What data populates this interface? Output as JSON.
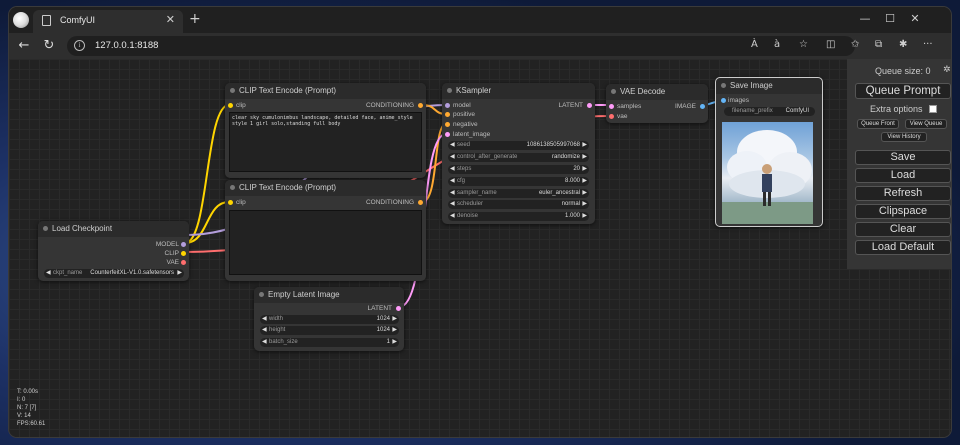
{
  "browser": {
    "tab_title": "ComfyUI",
    "url": "127.0.0.1:8188",
    "window_controls": {
      "minimize": "—",
      "maximize": "☐",
      "close": "✕"
    },
    "tab_close": "✕",
    "new_tab": "+",
    "toolbar_icons": [
      "read-aloud-icon",
      "translate-icon",
      "favorite-icon",
      "split-screen-icon",
      "favorites-icon",
      "collections-icon",
      "extensions-icon",
      "more-icon"
    ],
    "toolbar_glyphs": {
      "read_aloud": "À",
      "translate": "à",
      "favorite": "☆",
      "split": "◫",
      "favorites": "✩",
      "collections": "⧉",
      "extensions": "✱",
      "more": "···"
    },
    "nav_glyphs": {
      "back": "←",
      "refresh": "↻",
      "info": "i"
    }
  },
  "nodes": {
    "clip_text_1": {
      "title": "CLIP Text Encode (Prompt)",
      "input": "clip",
      "output": "CONDITIONING",
      "text": "clear sky cumulonimbus landscape, detailed face, anime_style style 1 girl solo,standing full body"
    },
    "clip_text_2": {
      "title": "CLIP Text Encode (Prompt)",
      "input": "clip",
      "output": "CONDITIONING",
      "text": ""
    },
    "load_checkpoint": {
      "title": "Load Checkpoint",
      "outputs": [
        "MODEL",
        "CLIP",
        "VAE"
      ],
      "widget_label": "ckpt_name",
      "widget_value": "CounterfeitXL-V1.0.safetensors"
    },
    "ksampler": {
      "title": "KSampler",
      "inputs": [
        "model",
        "positive",
        "negative",
        "latent_image"
      ],
      "output": "LATENT",
      "widgets": [
        {
          "label": "seed",
          "value": "1086138505997068"
        },
        {
          "label": "control_after_generate",
          "value": "randomize"
        },
        {
          "label": "steps",
          "value": "20"
        },
        {
          "label": "cfg",
          "value": "8.000"
        },
        {
          "label": "sampler_name",
          "value": "euler_ancestral"
        },
        {
          "label": "scheduler",
          "value": "normal"
        },
        {
          "label": "denoise",
          "value": "1.000"
        }
      ]
    },
    "vae_decode": {
      "title": "VAE Decode",
      "inputs": [
        "samples",
        "vae"
      ],
      "output": "IMAGE"
    },
    "save_image": {
      "title": "Save Image",
      "input": "images",
      "widget_label": "filename_prefix",
      "widget_value": "ComfyUI"
    },
    "empty_latent": {
      "title": "Empty Latent Image",
      "output": "LATENT",
      "widgets": [
        {
          "label": "width",
          "value": "1024"
        },
        {
          "label": "height",
          "value": "1024"
        },
        {
          "label": "batch_size",
          "value": "1"
        }
      ]
    }
  },
  "menu": {
    "queue_size": "Queue size: 0",
    "queue_prompt": "Queue Prompt",
    "extra_options": "Extra options",
    "queue_front": "Queue Front",
    "view_queue": "View Queue",
    "view_history": "View History",
    "save": "Save",
    "load": "Load",
    "refresh": "Refresh",
    "clipspace": "Clipspace",
    "clear": "Clear",
    "load_default": "Load Default",
    "gear": "✲"
  },
  "stats": {
    "t": "T: 0.00s",
    "i": "I: 0",
    "n": "N: 7 [7]",
    "v": "V: 14",
    "fps": "FPS:60.61"
  },
  "arrows": {
    "left": "◀",
    "right": "▶"
  },
  "colors": {
    "clip_wire": "#FFD500",
    "model_wire": "#B39DDB",
    "vae_wire": "#FF6E6E",
    "conditioning_wire": "#FFA931",
    "latent_wire": "#FF9CF9",
    "image_wire": "#64B5F6"
  }
}
